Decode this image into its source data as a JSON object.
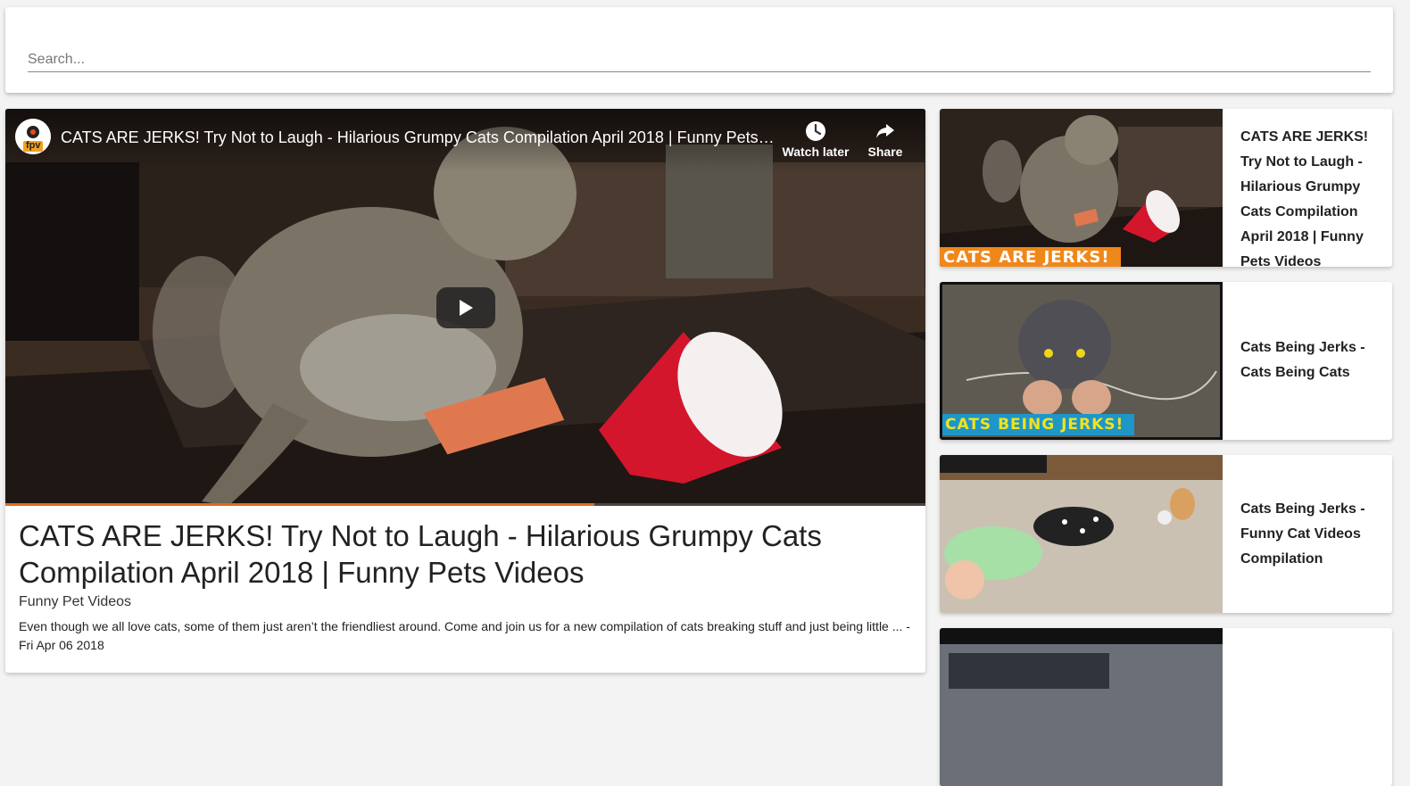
{
  "search": {
    "placeholder": "Search..."
  },
  "player": {
    "title": "CATS ARE JERKS! Try Not to Laugh - Hilarious Grumpy Cats Compilation April 2018 | Funny Pets Vid...",
    "channel_logo_text": "fpv",
    "watch_later_label": "Watch later",
    "share_label": "Share",
    "icons": [
      "clock-icon",
      "share-icon",
      "play-icon"
    ],
    "progress": 0.64,
    "progress_color": "#e06a1c"
  },
  "main": {
    "title": "CATS ARE JERKS! Try Not to Laugh - Hilarious Grumpy Cats Compilation April 2018 | Funny Pets Videos",
    "channel": "Funny Pet Videos",
    "description": "Even though we all love cats, some of them just aren’t the friendliest around. Come and join us for a new compilation of cats breaking stuff and just being little ... - Fri Apr 06 2018"
  },
  "related": [
    {
      "title": "CATS ARE JERKS! Try Not to Laugh - Hilarious Grumpy Cats Compilation April 2018 | Funny Pets Videos",
      "thumb_caption": "CATS ARE JERKS!"
    },
    {
      "title": "Cats Being Jerks - Cats Being Cats",
      "thumb_caption": "CATS BEING JERKS!"
    },
    {
      "title": "Cats Being Jerks - Funny Cat Videos Compilation"
    },
    {
      "title": ""
    }
  ]
}
